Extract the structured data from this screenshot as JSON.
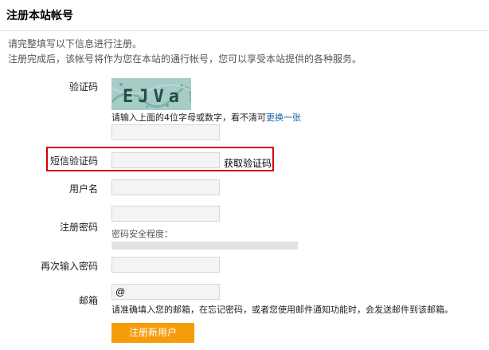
{
  "title": "注册本站帐号",
  "intro": {
    "line1": "请完整填写以下信息进行注册。",
    "line2": "注册完成后，该帐号将作为您在本站的通行帐号，您可以享受本站提供的各种服务。"
  },
  "captcha": {
    "label": "验证码",
    "image_text": "EJVa",
    "hint": "请输入上面的4位字母或数字，看不清可",
    "refresh_link": "更换一张",
    "value": ""
  },
  "sms": {
    "label": "短信验证码",
    "value": "",
    "get_code_button": "获取验证码",
    "highlight_color": "#d40000"
  },
  "username": {
    "label": "用户名",
    "value": ""
  },
  "password": {
    "label": "注册密码",
    "value": "",
    "strength_label": "密码安全程度："
  },
  "confirm_password": {
    "label": "再次输入密码",
    "value": ""
  },
  "email": {
    "label": "邮箱",
    "value": "@",
    "hint": "请准确填入您的邮箱，在忘记密码，或者您使用邮件通知功能时，会发送邮件到该邮箱。"
  },
  "submit_button": "注册新用户",
  "colors": {
    "accent": "#f59c0b",
    "link": "#1c5fa8"
  }
}
